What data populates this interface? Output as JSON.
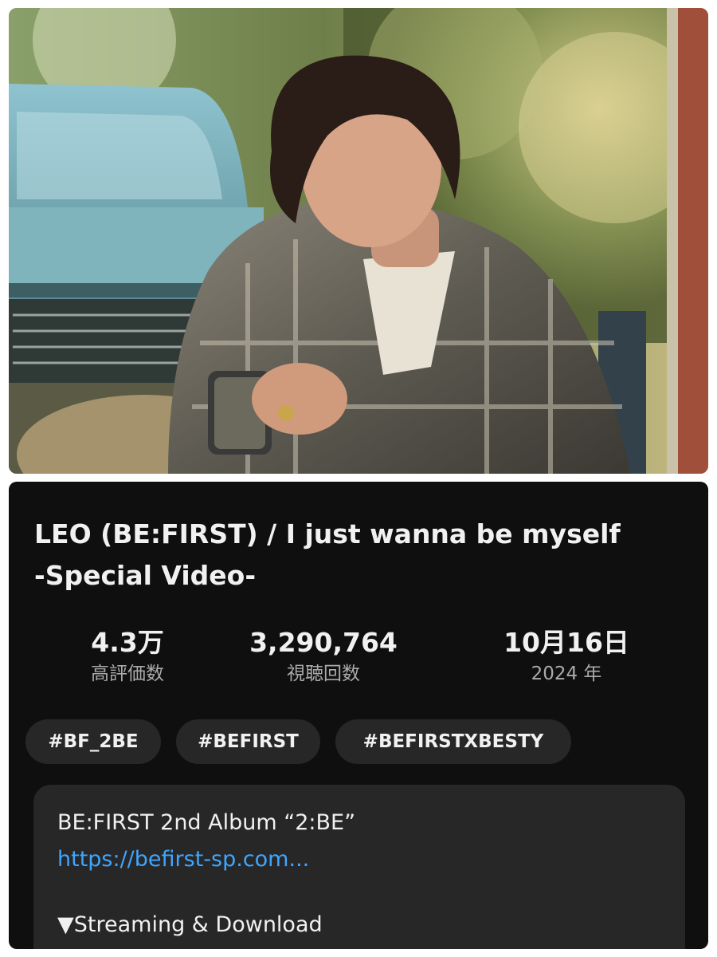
{
  "video": {
    "title_line1": "LEO (BE:FIRST) / I just wanna be myself",
    "title_line2": "-Special Video-"
  },
  "stats": {
    "likes_value": "4.3万",
    "likes_label": "高評価数",
    "views_value": "3,290,764",
    "views_label": "視聴回数",
    "date_value": "10月16日",
    "date_label": "2024 年"
  },
  "hashtags": [
    "#BF_2BE",
    "#BEFIRST",
    "#BEFIRSTXBESTY"
  ],
  "description": {
    "album_line": "BE:FIRST 2nd Album “2:BE”",
    "link_text": "https://befirst-sp.com...",
    "streaming_line": "▼Streaming & Download"
  },
  "colors": {
    "panel_background": "#0f0f0f",
    "chip_background": "#272727",
    "link": "#3ea6ff",
    "secondary_text": "#aaaaaa"
  }
}
